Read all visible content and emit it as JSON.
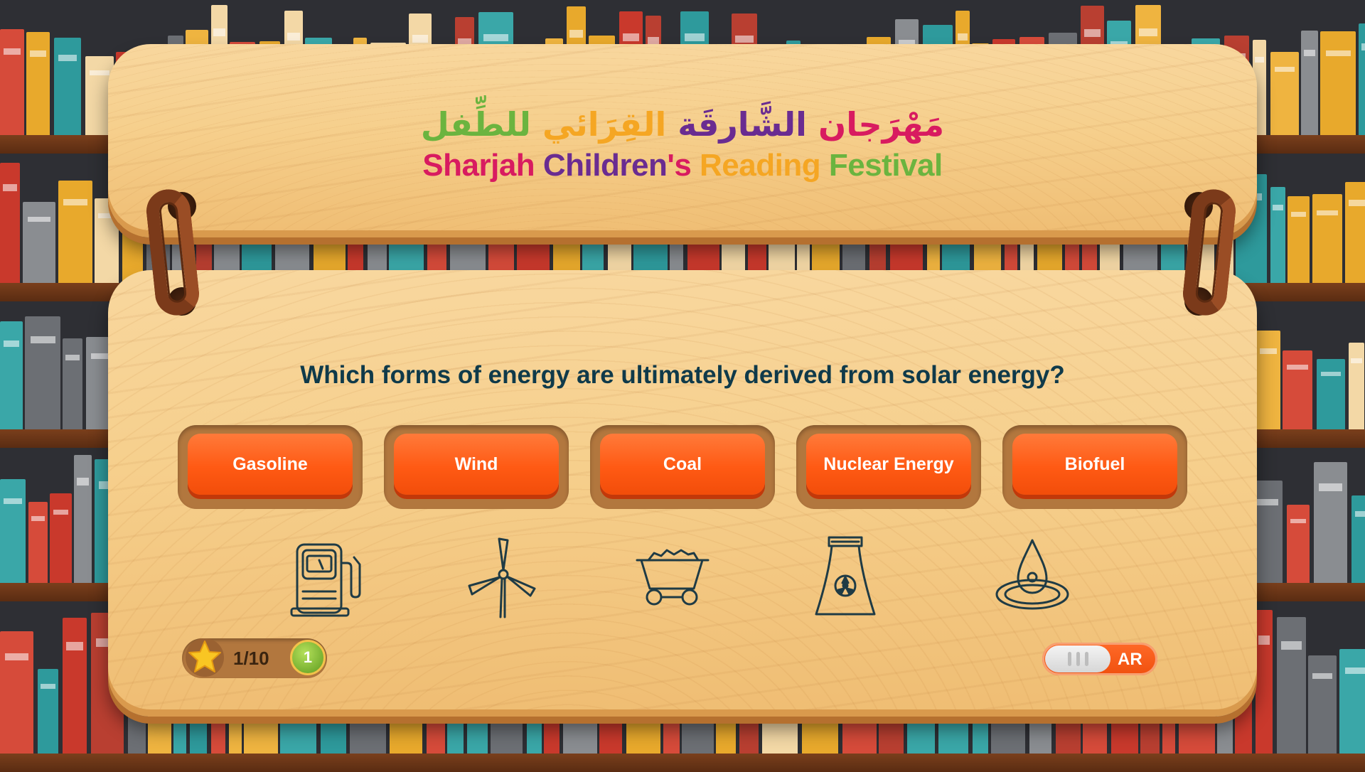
{
  "header": {
    "title_ar_parts": [
      "مَهْرَجان",
      "الشَّارقَة",
      "القِرَائي",
      "للطِّفل"
    ],
    "title_en_parts": [
      "Sharjah",
      "Children",
      "'s",
      "Reading",
      "Festival"
    ]
  },
  "quiz": {
    "question": "Which forms of energy are ultimately derived from solar energy?",
    "answers": [
      {
        "label": "Gasoline",
        "icon": "gas-pump-icon"
      },
      {
        "label": "Wind",
        "icon": "wind-turbine-icon"
      },
      {
        "label": "Coal",
        "icon": "coal-cart-icon"
      },
      {
        "label": "Nuclear Energy",
        "icon": "nuclear-plant-icon"
      },
      {
        "label": "Biofuel",
        "icon": "oil-drop-icon"
      }
    ]
  },
  "score": {
    "progress": "1/10",
    "coins": "1",
    "star_icon": "star-icon"
  },
  "language_toggle": {
    "label": "AR"
  },
  "colors": {
    "button": "#ff5a14",
    "question": "#0f3a4a",
    "pink": "#d81b60",
    "purple": "#6a2c91",
    "orange": "#f5a623",
    "green": "#6bb43f"
  }
}
